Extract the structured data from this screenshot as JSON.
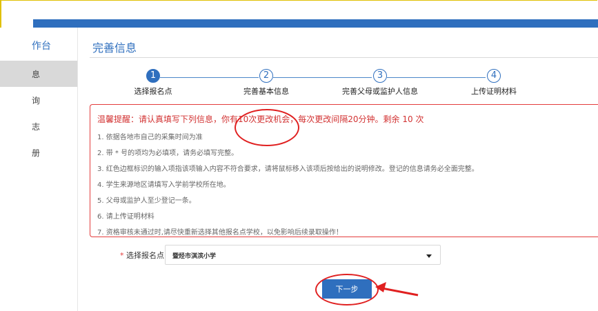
{
  "sidebar": {
    "title": "作台",
    "items": [
      {
        "label": "息",
        "active": true
      },
      {
        "label": "询",
        "active": false
      },
      {
        "label": "志",
        "active": false
      },
      {
        "label": "册",
        "active": false
      }
    ]
  },
  "main": {
    "title": "完善信息"
  },
  "steps": [
    {
      "number": "1",
      "label": "选择报名点",
      "active": true
    },
    {
      "number": "2",
      "label": "完善基本信息",
      "active": false
    },
    {
      "number": "3",
      "label": "完善父母或监护人信息",
      "active": false
    },
    {
      "number": "4",
      "label": "上传证明材料",
      "active": false
    }
  ],
  "notice": {
    "headline": "温馨提醒：请认真填写下列信息，你有10次更改机会，每次更改间隔20分钟。剩余 10 次",
    "items": [
      "1. 依据各地市自己的采集时间为准",
      "2. 带 * 号的项均为必填项，请务必填写完整。",
      "3. 红色边框标识的输入项指该项输入内容不符合要求，请将鼠标移入该项后按给出的说明修改。登记的信息请务必全面完整。",
      "4. 学生来源地区请填写入学前学校所在地。",
      "5. 父母或监护人至少登记一条。",
      "6. 请上传证明材料",
      "7. 资格审核未通过时,请尽快重新选择其他报名点学校，以免影响后续录取操作！"
    ]
  },
  "form": {
    "required_mark": "*",
    "select_label": "选择报名点",
    "select_value": "暨烃市淇滨小学"
  },
  "buttons": {
    "next": "下一步"
  },
  "colors": {
    "accent": "#2f6fbe",
    "alert": "#e33b3b",
    "annotation": "#e02020"
  }
}
